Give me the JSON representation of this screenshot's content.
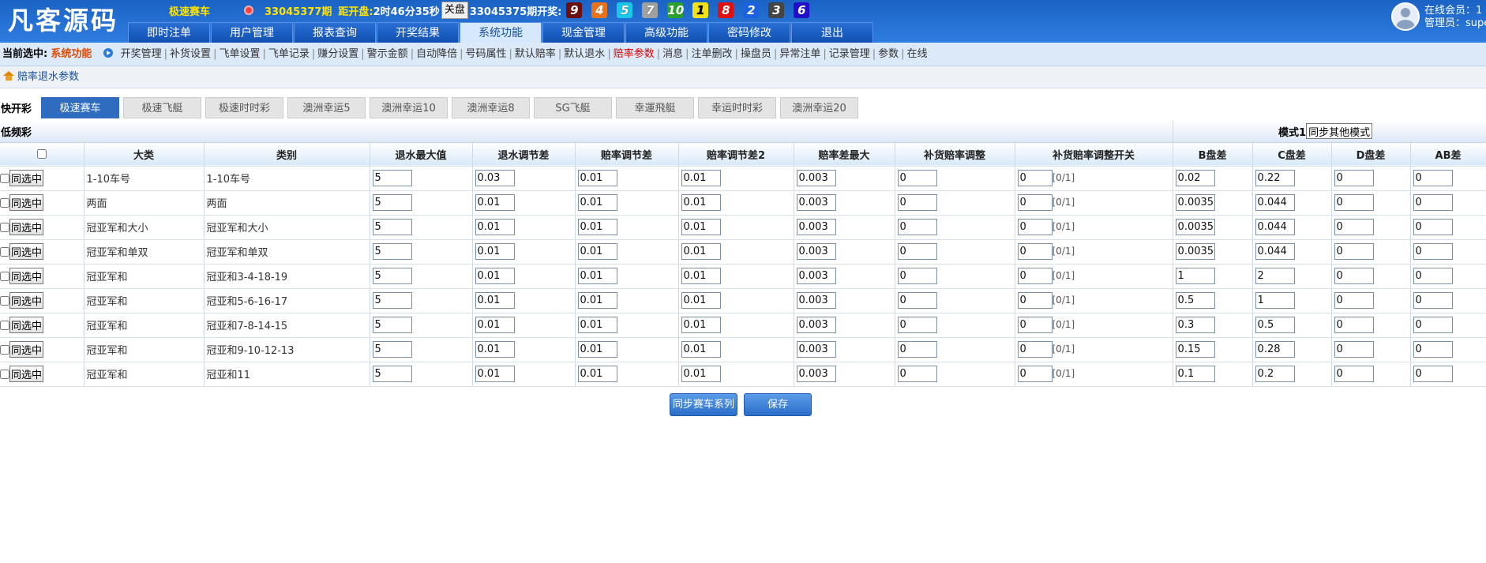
{
  "brand": {
    "logo": "凡客源码"
  },
  "topbar": {
    "game_name": "极速赛车",
    "period_current": "33045377期",
    "countdown_label": "距开盘:",
    "countdown": "2时46分35秒",
    "close_label": "关盘",
    "period_last": "33045375期开奖:",
    "balls": [
      {
        "n": "9",
        "color": "#6b0f0f"
      },
      {
        "n": "4",
        "color": "#e8731c"
      },
      {
        "n": "5",
        "color": "#19c8e8"
      },
      {
        "n": "7",
        "color": "#a0a0a0"
      },
      {
        "n": "10",
        "color": "#2aa12a"
      },
      {
        "n": "1",
        "color": "#f2e21a"
      },
      {
        "n": "8",
        "color": "#e01010"
      },
      {
        "n": "2",
        "color": "#1a62e0"
      },
      {
        "n": "3",
        "color": "#444444"
      },
      {
        "n": "6",
        "color": "#2010c8"
      }
    ]
  },
  "user": {
    "online": "在线会员：1",
    "admin": "管理员：super"
  },
  "nav": [
    "即时注单",
    "用户管理",
    "报表查询",
    "开奖结果",
    "系统功能",
    "现金管理",
    "高级功能",
    "密码修改",
    "退出"
  ],
  "nav_active": 4,
  "submenu": {
    "label": "当前选中:",
    "current": "系统功能",
    "items": [
      "开奖管理",
      "补货设置",
      "飞单设置",
      "飞单记录",
      "赚分设置",
      "警示金额",
      "自动降倍",
      "号码属性",
      "默认赔率",
      "默认退水",
      "赔率参数",
      "消息",
      "注单删改",
      "操盘员",
      "异常注单",
      "记录管理",
      "参数",
      "在线"
    ],
    "active": 10
  },
  "breadcrumb": "赔率退水参数",
  "tabs": {
    "label": "快开彩",
    "items": [
      "极速赛车",
      "极速飞艇",
      "极速时时彩",
      "澳洲幸运5",
      "澳洲幸运10",
      "澳洲幸运8",
      "SG飞艇",
      "幸運飛艇",
      "幸运时时彩",
      "澳洲幸运20"
    ],
    "active": 0
  },
  "table": {
    "section_label": "低频彩",
    "mode_label": "模式1",
    "mode_button": "同步其他模式",
    "headers": [
      "大类",
      "类别",
      "退水最大值",
      "退水调节差",
      "赔率调节差",
      "赔率调节差2",
      "赔率差最大",
      "补货赔率调整",
      "补货赔率调整开关",
      "B盘差",
      "C盘差",
      "D盘差",
      "AB差"
    ],
    "same_btn": "同选中",
    "switch_hint": "[0/1]",
    "rows": [
      {
        "cat": "1-10车号",
        "type": "1-10车号",
        "v": [
          "5",
          "0.03",
          "0.01",
          "0.01",
          "0.003",
          "0",
          "0",
          "0.02",
          "0.22",
          "0",
          "0"
        ]
      },
      {
        "cat": "两面",
        "type": "两面",
        "v": [
          "5",
          "0.01",
          "0.01",
          "0.01",
          "0.003",
          "0",
          "0",
          "0.0035",
          "0.044",
          "0",
          "0"
        ]
      },
      {
        "cat": "冠亚军和大小",
        "type": "冠亚军和大小",
        "v": [
          "5",
          "0.01",
          "0.01",
          "0.01",
          "0.003",
          "0",
          "0",
          "0.0035",
          "0.044",
          "0",
          "0"
        ]
      },
      {
        "cat": "冠亚军和单双",
        "type": "冠亚军和单双",
        "v": [
          "5",
          "0.01",
          "0.01",
          "0.01",
          "0.003",
          "0",
          "0",
          "0.0035",
          "0.044",
          "0",
          "0"
        ]
      },
      {
        "cat": "冠亚军和",
        "type": "冠亚和3-4-18-19",
        "v": [
          "5",
          "0.01",
          "0.01",
          "0.01",
          "0.003",
          "0",
          "0",
          "1",
          "2",
          "0",
          "0"
        ]
      },
      {
        "cat": "冠亚军和",
        "type": "冠亚和5-6-16-17",
        "v": [
          "5",
          "0.01",
          "0.01",
          "0.01",
          "0.003",
          "0",
          "0",
          "0.5",
          "1",
          "0",
          "0"
        ]
      },
      {
        "cat": "冠亚军和",
        "type": "冠亚和7-8-14-15",
        "v": [
          "5",
          "0.01",
          "0.01",
          "0.01",
          "0.003",
          "0",
          "0",
          "0.3",
          "0.5",
          "0",
          "0"
        ]
      },
      {
        "cat": "冠亚军和",
        "type": "冠亚和9-10-12-13",
        "v": [
          "5",
          "0.01",
          "0.01",
          "0.01",
          "0.003",
          "0",
          "0",
          "0.15",
          "0.28",
          "0",
          "0"
        ]
      },
      {
        "cat": "冠亚军和",
        "type": "冠亚和11",
        "v": [
          "5",
          "0.01",
          "0.01",
          "0.01",
          "0.003",
          "0",
          "0",
          "0.1",
          "0.2",
          "0",
          "0"
        ]
      }
    ]
  },
  "actions": {
    "sync": "同步赛车系列",
    "save": "保存"
  }
}
